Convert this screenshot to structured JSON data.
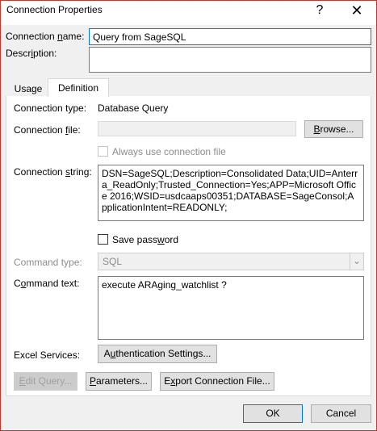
{
  "window": {
    "title": "Connection Properties",
    "help_icon": "?",
    "close_icon": "✕"
  },
  "top": {
    "connection_name_label": "Connection name:",
    "connection_name_value": "Query from SageSQL",
    "description_label": "Description:",
    "description_value": ""
  },
  "tabs": [
    {
      "label": "Usage"
    },
    {
      "label": "Definition",
      "active": true
    }
  ],
  "definition": {
    "connection_type_label": "Connection type:",
    "connection_type_value": "Database Query",
    "connection_file_label": "Connection file:",
    "connection_file_value": "",
    "browse_button": "Browse...",
    "always_use_label": "Always use connection file",
    "connection_string_label": "Connection string:",
    "connection_string_value": "DSN=SageSQL;Description=Consolidated Data;UID=Anterra_ReadOnly;Trusted_Connection=Yes;APP=Microsoft Office 2016;WSID=usdcaaps00351;DATABASE=SageConsol;ApplicationIntent=READONLY;",
    "save_password_label": "Save password",
    "command_type_label": "Command type:",
    "command_type_value": "SQL",
    "command_text_label": "Command text:",
    "command_text_value": "execute ARAging_watchlist ?",
    "excel_services_label": "Excel Services:",
    "auth_settings_button": "Authentication Settings...",
    "edit_query_button": "Edit Query...",
    "parameters_button": "Parameters...",
    "export_button": "Export Connection File..."
  },
  "footer": {
    "ok_button": "OK",
    "cancel_button": "Cancel"
  }
}
